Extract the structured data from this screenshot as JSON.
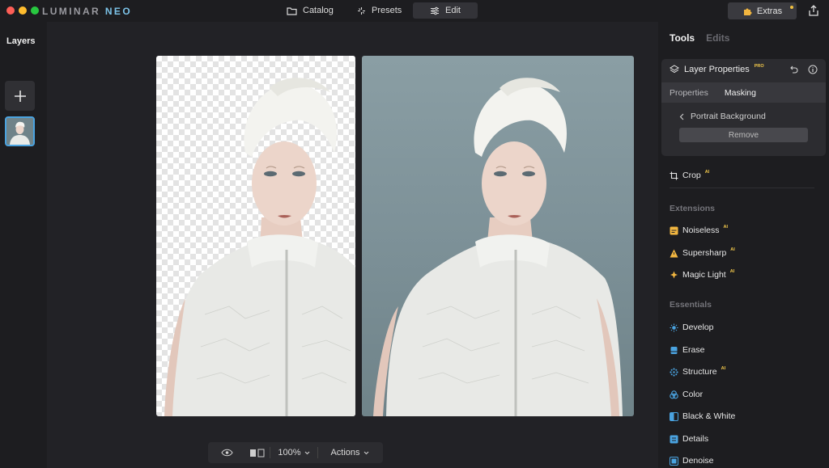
{
  "app": {
    "logo_main": "LUMINAR",
    "logo_accent": "NEO"
  },
  "topnav": {
    "catalog": "Catalog",
    "presets": "Presets",
    "edit": "Edit",
    "extras": "Extras"
  },
  "layers": {
    "title": "Layers"
  },
  "right_panel": {
    "tab_tools": "Tools",
    "tab_edits": "Edits",
    "layer_properties": "Layer Properties",
    "pro_badge": "PRO",
    "subtab_properties": "Properties",
    "subtab_masking": "Masking",
    "back_label": "Portrait Background",
    "remove_label": "Remove"
  },
  "tools": {
    "crop": "Crop",
    "extensions_heading": "Extensions",
    "noiseless": "Noiseless",
    "supersharp": "Supersharp",
    "magic_light": "Magic Light",
    "essentials_heading": "Essentials",
    "develop": "Develop",
    "erase": "Erase",
    "structure": "Structure",
    "color": "Color",
    "black_white": "Black & White",
    "details": "Details",
    "denoise": "Denoise",
    "ai_badge": "AI"
  },
  "bottom_bar": {
    "zoom": "100%",
    "actions": "Actions"
  },
  "colors": {
    "accent": "#4aa3e0",
    "badge": "#f2c84b"
  }
}
